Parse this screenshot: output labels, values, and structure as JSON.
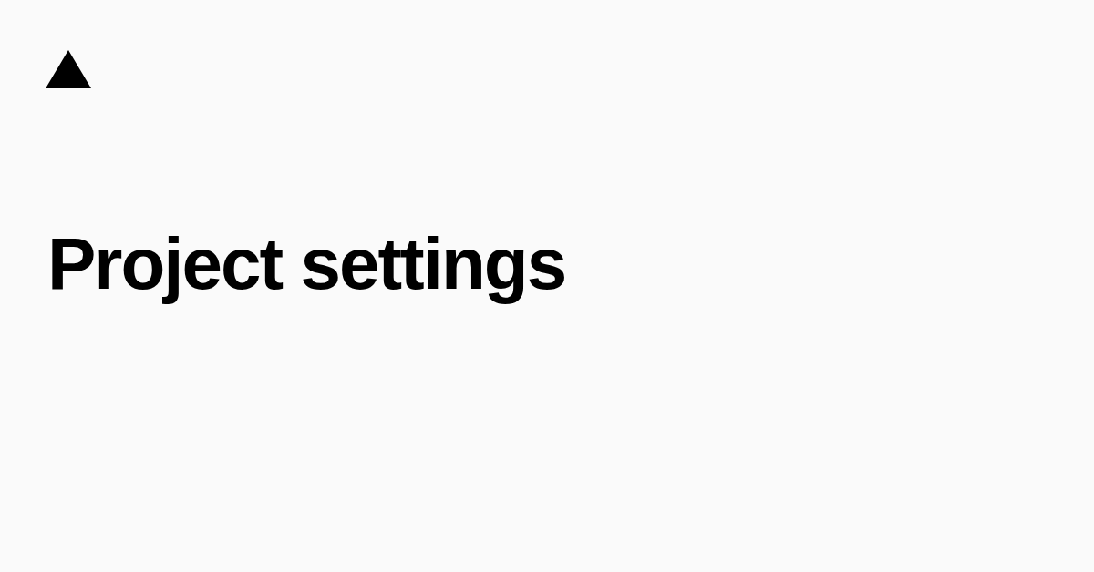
{
  "title": "Project settings"
}
